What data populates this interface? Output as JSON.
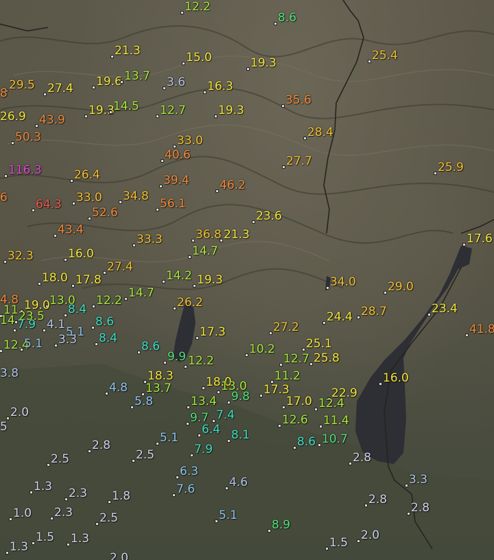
{
  "map": {
    "colors": {
      "c_magenta": "#e24ad0",
      "c_red": "#ee5a4e",
      "c_orange": "#f0893b",
      "c_yellow_orange": "#f2bf30",
      "c_yellow": "#f2e53a",
      "c_yellow_green": "#a6e83a",
      "c_green": "#52e07a",
      "c_teal": "#3fdcc2",
      "c_light_blue": "#8ec2ee",
      "c_pale_blue": "#b4c3e8",
      "c_lavender": "#cfd1ea"
    },
    "stations": [
      {
        "v": "12.2",
        "c": "c_yellow_green"
      },
      {
        "v": "8.6",
        "c": "c_green"
      },
      {
        "v": "21.3",
        "c": "c_yellow"
      },
      {
        "v": "15.0",
        "c": "c_yellow"
      },
      {
        "v": "19.3",
        "c": "c_yellow"
      },
      {
        "v": "25.4",
        "c": "c_yellow_orange"
      },
      {
        "v": "29.5",
        "c": "c_yellow_orange"
      },
      {
        "v": "27.4",
        "c": "c_yellow"
      },
      {
        "v": "19.6",
        "c": "c_yellow"
      },
      {
        "v": "13.7",
        "c": "c_yellow_green"
      },
      {
        "v": "3.6",
        "c": "c_pale_blue"
      },
      {
        "v": "16.3",
        "c": "c_yellow"
      },
      {
        "v": "8",
        "c": "c_orange"
      },
      {
        "v": "19.3",
        "c": "c_yellow"
      },
      {
        "v": "14.5",
        "c": "c_yellow_green"
      },
      {
        "v": "12.7",
        "c": "c_yellow_green"
      },
      {
        "v": "19.3",
        "c": "c_yellow"
      },
      {
        "v": "35.6",
        "c": "c_orange"
      },
      {
        "v": "26.9",
        "c": "c_yellow"
      },
      {
        "v": "43.9",
        "c": "c_orange"
      },
      {
        "v": "50.3",
        "c": "c_orange"
      },
      {
        "v": "28.4",
        "c": "c_yellow_orange"
      },
      {
        "v": "33.0",
        "c": "c_yellow_orange"
      },
      {
        "v": "40.6",
        "c": "c_orange"
      },
      {
        "v": "27.7",
        "c": "c_yellow_orange"
      },
      {
        "v": "25.9",
        "c": "c_yellow_orange"
      },
      {
        "v": "116.3",
        "c": "c_magenta"
      },
      {
        "v": "26.4",
        "c": "c_yellow_orange"
      },
      {
        "v": "39.4",
        "c": "c_orange"
      },
      {
        "v": "46.2",
        "c": "c_orange"
      },
      {
        "v": "6",
        "c": "c_orange"
      },
      {
        "v": "64.3",
        "c": "c_red"
      },
      {
        "v": "33.0",
        "c": "c_yellow_orange"
      },
      {
        "v": "34.8",
        "c": "c_yellow_orange"
      },
      {
        "v": "56.1",
        "c": "c_orange"
      },
      {
        "v": "52.6",
        "c": "c_orange"
      },
      {
        "v": "23.6",
        "c": "c_yellow"
      },
      {
        "v": "43.4",
        "c": "c_orange"
      },
      {
        "v": "36.8",
        "c": "c_yellow_orange"
      },
      {
        "v": "21.3",
        "c": "c_yellow"
      },
      {
        "v": "33.3",
        "c": "c_yellow_orange"
      },
      {
        "v": "17.6",
        "c": "c_yellow"
      },
      {
        "v": "32.3",
        "c": "c_yellow_orange"
      },
      {
        "v": "16.0",
        "c": "c_yellow"
      },
      {
        "v": "14.7",
        "c": "c_yellow_green"
      },
      {
        "v": "27.4",
        "c": "c_yellow_orange"
      },
      {
        "v": "18.0",
        "c": "c_yellow"
      },
      {
        "v": "17.8",
        "c": "c_yellow"
      },
      {
        "v": "14.2",
        "c": "c_yellow_green"
      },
      {
        "v": "19.3",
        "c": "c_yellow"
      },
      {
        "v": "34.0",
        "c": "c_yellow_orange"
      },
      {
        "v": "29.0",
        "c": "c_yellow_orange"
      },
      {
        "v": "4.8",
        "c": "c_orange"
      },
      {
        "v": "12.2",
        "c": "c_yellow_green"
      },
      {
        "v": "14.7",
        "c": "c_yellow_green"
      },
      {
        "v": "13.0",
        "c": "c_yellow_green"
      },
      {
        "v": "19.0",
        "c": "c_yellow"
      },
      {
        "v": "26.2",
        "c": "c_yellow_orange"
      },
      {
        "v": "23.4",
        "c": "c_yellow"
      },
      {
        "v": "8.4",
        "c": "c_teal"
      },
      {
        "v": "24.4",
        "c": "c_yellow"
      },
      {
        "v": "28.7",
        "c": "c_yellow_orange"
      },
      {
        "v": "11",
        "c": "c_yellow_green"
      },
      {
        "v": "14",
        "c": "c_yellow_green"
      },
      {
        "v": "23.5",
        "c": "c_yellow_green"
      },
      {
        "v": "8.6",
        "c": "c_teal"
      },
      {
        "v": "4.1",
        "c": "c_pale_blue"
      },
      {
        "v": "7.9",
        "c": "c_teal"
      },
      {
        "v": "27.2",
        "c": "c_yellow_orange"
      },
      {
        "v": "41.8",
        "c": "c_orange"
      },
      {
        "v": "5.1",
        "c": "c_light_blue"
      },
      {
        "v": "17.3",
        "c": "c_yellow"
      },
      {
        "v": "8.4",
        "c": "c_teal"
      },
      {
        "v": "3.3",
        "c": "c_pale_blue"
      },
      {
        "v": "12.4",
        "c": "c_yellow_green"
      },
      {
        "v": "5.1",
        "c": "c_light_blue"
      },
      {
        "v": "25.1",
        "c": "c_yellow"
      },
      {
        "v": "8.6",
        "c": "c_teal"
      },
      {
        "v": "10.2",
        "c": "c_yellow_green"
      },
      {
        "v": "25.8",
        "c": "c_yellow"
      },
      {
        "v": "9.9",
        "c": "c_green"
      },
      {
        "v": "12.7",
        "c": "c_yellow_green"
      },
      {
        "v": "12.2",
        "c": "c_yellow_green"
      },
      {
        "v": "3.8",
        "c": "c_pale_blue"
      },
      {
        "v": "16.0",
        "c": "c_yellow"
      },
      {
        "v": "18.3",
        "c": "c_yellow"
      },
      {
        "v": "11.2",
        "c": "c_yellow_green"
      },
      {
        "v": "18.0",
        "c": "c_yellow"
      },
      {
        "v": "13.0",
        "c": "c_yellow_green"
      },
      {
        "v": "4.8",
        "c": "c_light_blue"
      },
      {
        "v": "13.7",
        "c": "c_yellow_green"
      },
      {
        "v": "17.3",
        "c": "c_yellow"
      },
      {
        "v": "22.9",
        "c": "c_yellow"
      },
      {
        "v": "9.8",
        "c": "c_green"
      },
      {
        "v": "5.8",
        "c": "c_light_blue"
      },
      {
        "v": "13.4",
        "c": "c_yellow_green"
      },
      {
        "v": "17.0",
        "c": "c_yellow"
      },
      {
        "v": "12.4",
        "c": "c_yellow_green"
      },
      {
        "v": "2.0",
        "c": "c_lavender"
      },
      {
        "v": "7.4",
        "c": "c_teal"
      },
      {
        "v": "9.7",
        "c": "c_green"
      },
      {
        "v": "12.6",
        "c": "c_yellow_green"
      },
      {
        "v": "11.4",
        "c": "c_yellow_green"
      },
      {
        "v": "5",
        "c": "c_lavender"
      },
      {
        "v": "6.4",
        "c": "c_teal"
      },
      {
        "v": "8.1",
        "c": "c_teal"
      },
      {
        "v": "5.1",
        "c": "c_light_blue"
      },
      {
        "v": "8.6",
        "c": "c_teal"
      },
      {
        "v": "10.7",
        "c": "c_green"
      },
      {
        "v": "2.8",
        "c": "c_lavender"
      },
      {
        "v": "7.9",
        "c": "c_teal"
      },
      {
        "v": "2.5",
        "c": "c_lavender"
      },
      {
        "v": "2.5",
        "c": "c_lavender"
      },
      {
        "v": "2.8",
        "c": "c_lavender"
      },
      {
        "v": "6.3",
        "c": "c_light_blue"
      },
      {
        "v": "3.3",
        "c": "c_pale_blue"
      },
      {
        "v": "1.3",
        "c": "c_lavender"
      },
      {
        "v": "4.6",
        "c": "c_pale_blue"
      },
      {
        "v": "7.6",
        "c": "c_light_blue"
      },
      {
        "v": "2.3",
        "c": "c_lavender"
      },
      {
        "v": "1.8",
        "c": "c_lavender"
      },
      {
        "v": "2.8",
        "c": "c_lavender"
      },
      {
        "v": "2.8",
        "c": "c_lavender"
      },
      {
        "v": "1.0",
        "c": "c_lavender"
      },
      {
        "v": "2.3",
        "c": "c_lavender"
      },
      {
        "v": "2.5",
        "c": "c_lavender"
      },
      {
        "v": "5.1",
        "c": "c_light_blue"
      },
      {
        "v": "8.9",
        "c": "c_green"
      },
      {
        "v": "1.5",
        "c": "c_lavender"
      },
      {
        "v": "1.3",
        "c": "c_lavender"
      },
      {
        "v": "2.0",
        "c": "c_lavender"
      },
      {
        "v": "1.3",
        "c": "c_lavender"
      },
      {
        "v": "1.5",
        "c": "c_lavender"
      },
      {
        "v": "2.0",
        "c": "c_lavender"
      }
    ]
  }
}
